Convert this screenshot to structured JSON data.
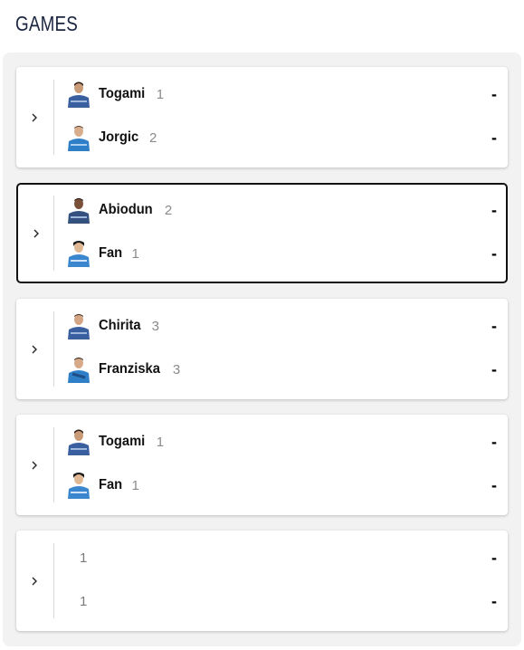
{
  "section_title": "GAMES",
  "icons": {
    "expand": "chevron-right-icon",
    "avatar": "player-avatar-icon"
  },
  "colors": {
    "panel_bg": "#f2f2f2",
    "card_bg": "#ffffff",
    "selected_border": "#111111",
    "jersey": "#3a5f9e",
    "title": "#1b2540"
  },
  "games": [
    {
      "selected": false,
      "players": [
        {
          "name": "Togami",
          "seed": "1",
          "score": "-",
          "avatar": true
        },
        {
          "name": "Jorgic",
          "seed": "2",
          "score": "-",
          "avatar": true
        }
      ]
    },
    {
      "selected": true,
      "players": [
        {
          "name": "Abiodun",
          "seed": "2",
          "score": "-",
          "avatar": true
        },
        {
          "name": "Fan",
          "seed": "1",
          "score": "-",
          "avatar": true
        }
      ]
    },
    {
      "selected": false,
      "players": [
        {
          "name": "Chirita",
          "seed": "3",
          "score": "-",
          "avatar": true
        },
        {
          "name": "Franziska",
          "seed": "3",
          "score": "-",
          "avatar": true
        }
      ]
    },
    {
      "selected": false,
      "players": [
        {
          "name": "Togami",
          "seed": "1",
          "score": "-",
          "avatar": true
        },
        {
          "name": "Fan",
          "seed": "1",
          "score": "-",
          "avatar": true
        }
      ]
    },
    {
      "selected": false,
      "players": [
        {
          "name": "",
          "seed": "1",
          "score": "-",
          "avatar": false
        },
        {
          "name": "",
          "seed": "1",
          "score": "-",
          "avatar": false
        }
      ]
    }
  ]
}
